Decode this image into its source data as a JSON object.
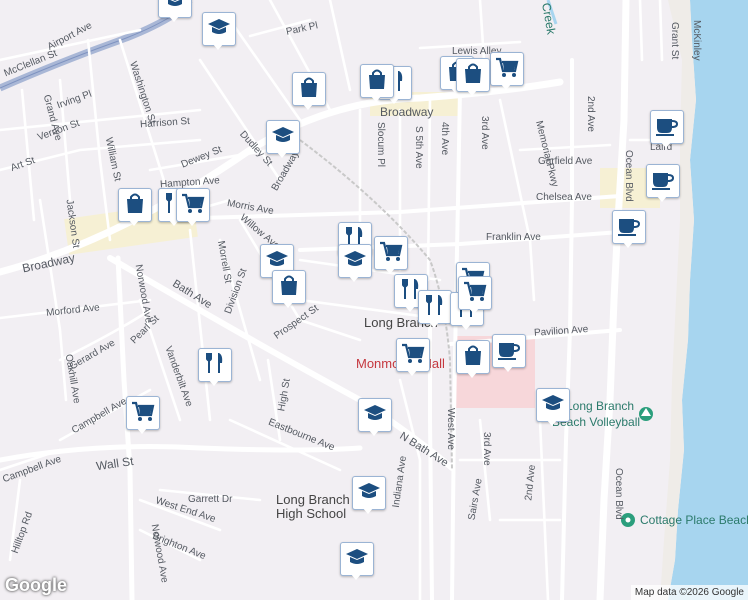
{
  "map": {
    "attribution": "Map data ©2026 Google",
    "logo": "Google",
    "place_labels": {
      "city": "Long Branch",
      "mall": "Monmouth Mall",
      "school": "Long Branch",
      "school_line2": "High School",
      "volleyball": "Long Branch",
      "volleyball_line2": "Beach Volleyball",
      "cottage": "Cottage Place Beach",
      "creek": "Creek"
    },
    "streets": {
      "mcclellan": "McClellan St",
      "airport": "Airport Ave",
      "washington": "Washington St",
      "park_pl": "Park Pl",
      "lewis_alley": "Lewis Alley",
      "grand": "Grand Ave",
      "irving": "Irving Pl",
      "vernon": "Vernon St",
      "william": "William St",
      "harrison": "Harrison St",
      "art": "Art St",
      "dewey": "Dewey St",
      "dudley": "Dudley St",
      "hampton": "Hampton Ave",
      "broadway": "Broadway",
      "broadway2": "Broadway",
      "slocum": "Slocum Pl",
      "s5th": "S 5th Ave",
      "ave4": "4th Ave",
      "ave3": "3rd Ave",
      "ave2": "2nd Ave",
      "memorial": "Memorial Pkwy",
      "garfield": "Garfield Ave",
      "laird": "Laird",
      "ocean": "Ocean Blvd",
      "ocean2": "Ocean Blvd",
      "chelsea": "Chelsea Ave",
      "franklin": "Franklin Ave",
      "morris": "Morris Ave",
      "jackson": "Jackson St",
      "willow": "Willow Ave",
      "morrell": "Morrell St",
      "norwood": "Norwood Ave",
      "norwood2": "Norwood Ave",
      "bath": "Bath Ave",
      "morford": "Morford Ave",
      "division": "Division St",
      "prospect": "Prospect St",
      "pearl": "Pearl St",
      "gerard": "Gerard Ave",
      "oakhill": "Oakhill Ave",
      "vanderbilt": "Vanderbilt Ave",
      "campbell": "Campbell Ave",
      "campbell2": "Campbell Ave",
      "high": "High St",
      "eastbourne": "Eastbourne Ave",
      "n_bath": "N Bath Ave",
      "west": "West Ave",
      "indiana": "Indiana Ave",
      "ave3b": "3rd Ave",
      "pavilion": "Pavilion Ave",
      "wall": "Wall St",
      "hilltop": "Hilltop Rd",
      "garrett": "Garrett Dr",
      "west_end": "West End Ave",
      "brighton": "Brighton Ave",
      "sairs": "Sairs Ave",
      "ave2b": "2nd Ave",
      "grant": "Grant St",
      "mckinley": "McKinley"
    },
    "colors": {
      "land": "#f2eff3",
      "road": "#ffffff",
      "highway": "#a9b7d6",
      "water": "#a7d5ef",
      "commercial": "#f6f0d4",
      "mall_area": "#f7d7da",
      "pin_icon": "#1c4e80",
      "park_dot": "#2b9e7c"
    },
    "pins": [
      {
        "icon": "school-icon",
        "kind": "school"
      },
      {
        "icon": "school-icon",
        "kind": "school"
      },
      {
        "icon": "shopping-bag-icon",
        "kind": "shopping"
      },
      {
        "icon": "restaurant-icon",
        "kind": "restaurant"
      },
      {
        "icon": "shopping-bag-icon",
        "kind": "shopping"
      },
      {
        "icon": "shopping-cart-icon",
        "kind": "grocery"
      },
      {
        "icon": "shopping-bag-icon",
        "kind": "shopping"
      },
      {
        "icon": "shopping-bag-icon",
        "kind": "shopping"
      },
      {
        "icon": "school-icon",
        "kind": "school"
      },
      {
        "icon": "cafe-icon",
        "kind": "cafe"
      },
      {
        "icon": "cafe-icon",
        "kind": "cafe"
      },
      {
        "icon": "cafe-icon",
        "kind": "cafe"
      },
      {
        "icon": "shopping-bag-icon",
        "kind": "shopping"
      },
      {
        "icon": "restaurant-icon",
        "kind": "restaurant"
      },
      {
        "icon": "shopping-cart-icon",
        "kind": "grocery"
      },
      {
        "icon": "restaurant-icon",
        "kind": "restaurant"
      },
      {
        "icon": "shopping-cart-icon",
        "kind": "grocery"
      },
      {
        "icon": "school-icon",
        "kind": "school"
      },
      {
        "icon": "school-icon",
        "kind": "school"
      },
      {
        "icon": "shopping-bag-icon",
        "kind": "shopping"
      },
      {
        "icon": "shopping-cart-icon",
        "kind": "grocery"
      },
      {
        "icon": "restaurant-icon",
        "kind": "restaurant"
      },
      {
        "icon": "restaurant-icon",
        "kind": "restaurant"
      },
      {
        "icon": "restaurant-icon",
        "kind": "restaurant"
      },
      {
        "icon": "shopping-cart-icon",
        "kind": "grocery"
      },
      {
        "icon": "shopping-bag-icon",
        "kind": "shopping"
      },
      {
        "icon": "cafe-icon",
        "kind": "cafe"
      },
      {
        "icon": "shopping-cart-icon",
        "kind": "grocery"
      },
      {
        "icon": "restaurant-icon",
        "kind": "restaurant"
      },
      {
        "icon": "school-icon",
        "kind": "school"
      },
      {
        "icon": "shopping-cart-icon",
        "kind": "grocery"
      },
      {
        "icon": "school-icon",
        "kind": "school"
      },
      {
        "icon": "school-icon",
        "kind": "school"
      },
      {
        "icon": "school-icon",
        "kind": "school"
      }
    ]
  }
}
